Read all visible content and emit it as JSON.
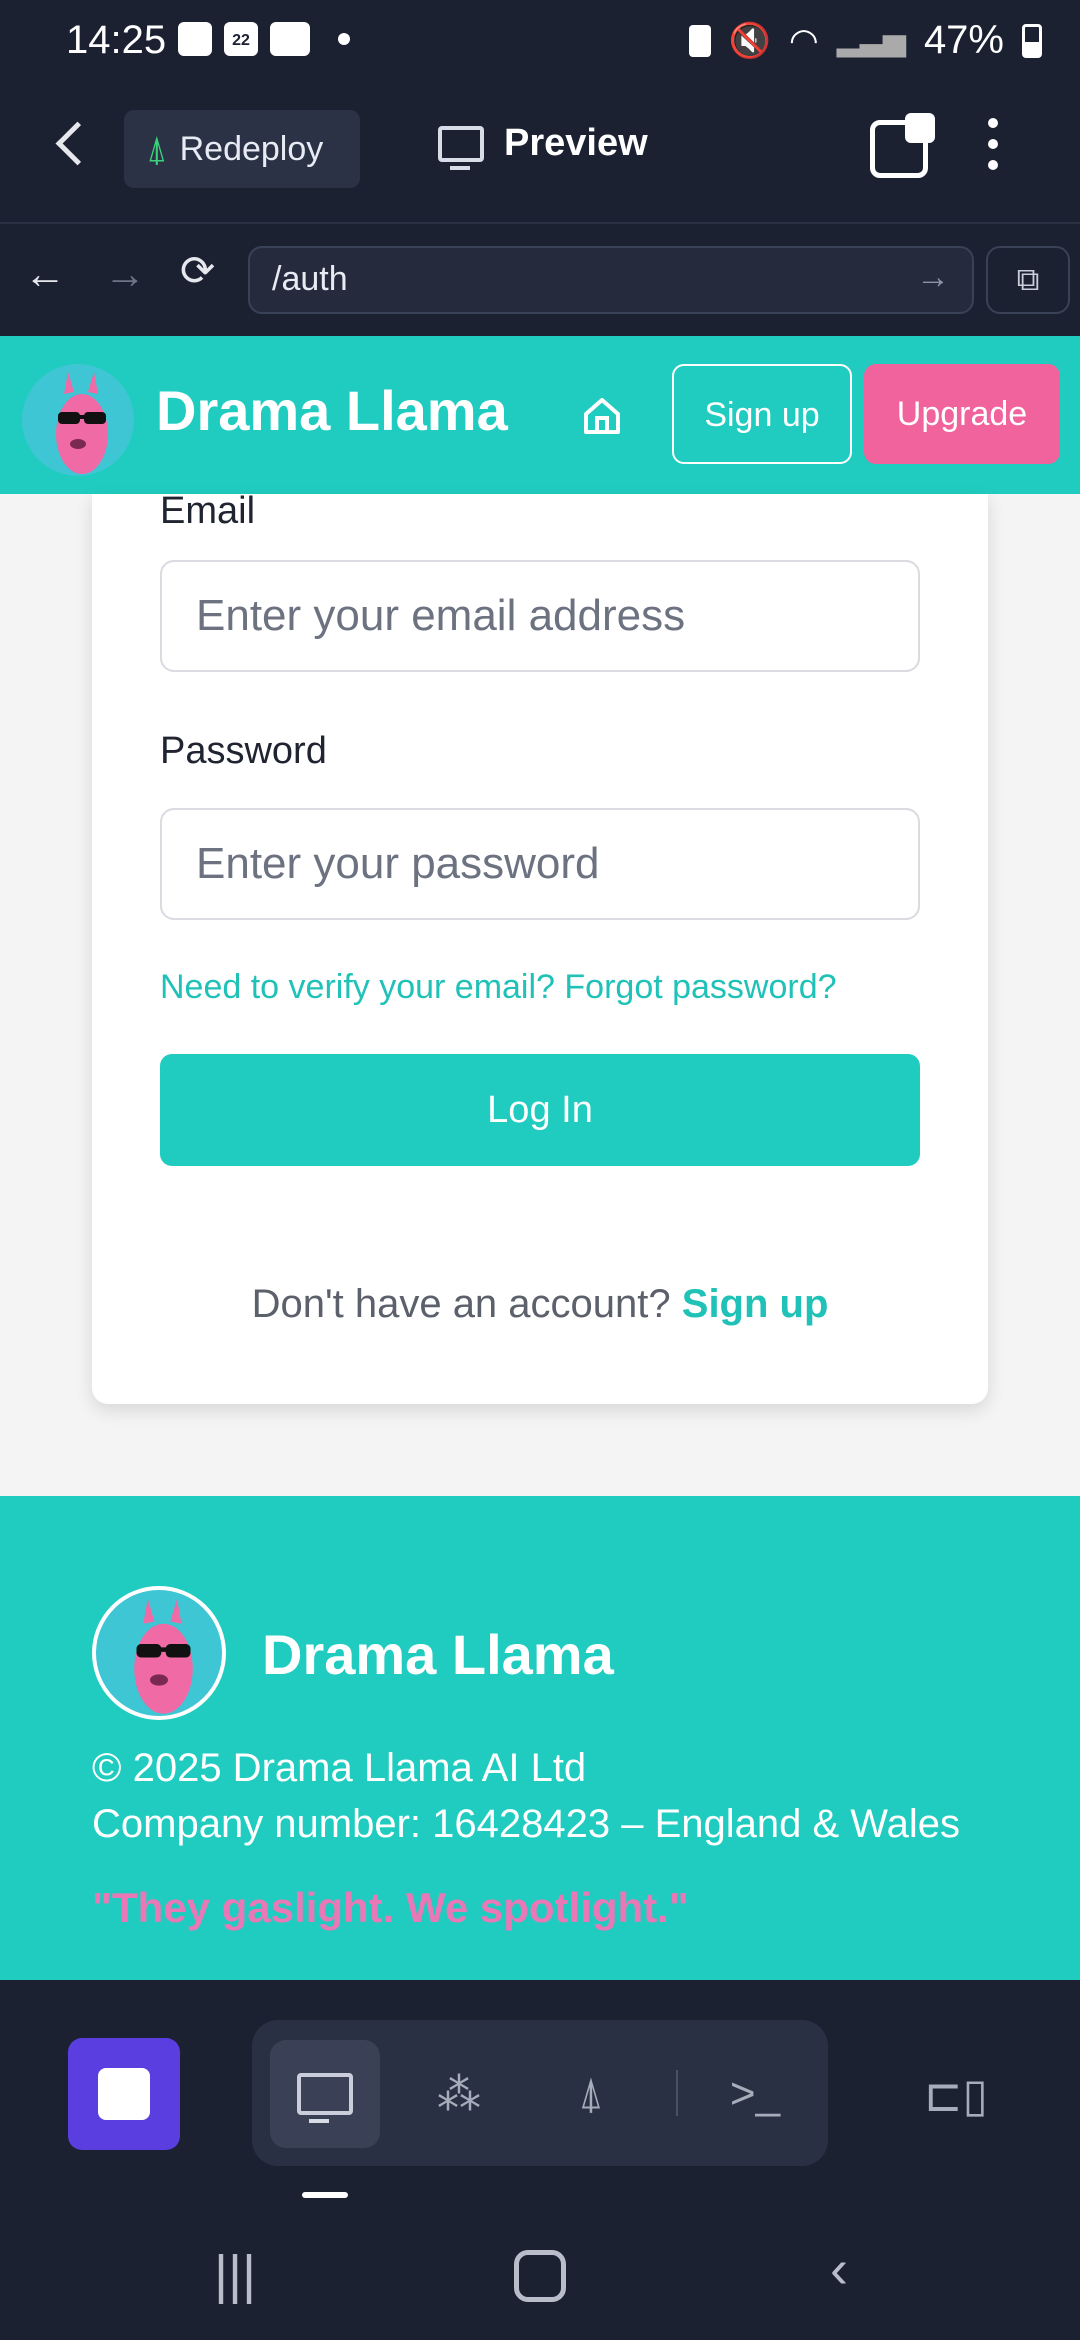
{
  "status_bar": {
    "time": "14:25",
    "calendar_day": "22",
    "battery": "47%"
  },
  "app_toolbar": {
    "redeploy_label": "Redeploy",
    "preview_label": "Preview"
  },
  "browser": {
    "url": "/auth"
  },
  "site_header": {
    "brand": "Drama Llama",
    "signup_label": "Sign up",
    "upgrade_label": "Upgrade"
  },
  "login_form": {
    "email_label": "Email",
    "email_placeholder": "Enter your email address",
    "password_label": "Password",
    "password_placeholder": "Enter your password",
    "verify_link": "Need to verify your email?",
    "forgot_link": "Forgot password?",
    "login_button": "Log In",
    "no_account_text": "Don't have an account?",
    "signup_link": "Sign up"
  },
  "footer": {
    "brand": "Drama Llama",
    "copyright": "© 2025 Drama Llama AI Ltd",
    "company": "Company number: 16428423 – England & Wales",
    "tagline": "\"They gaslight. We spotlight.\""
  },
  "colors": {
    "teal": "#20ccc0",
    "pink": "#f1639c",
    "dark": "#1c2132",
    "tagline_pink": "#e978b6"
  }
}
